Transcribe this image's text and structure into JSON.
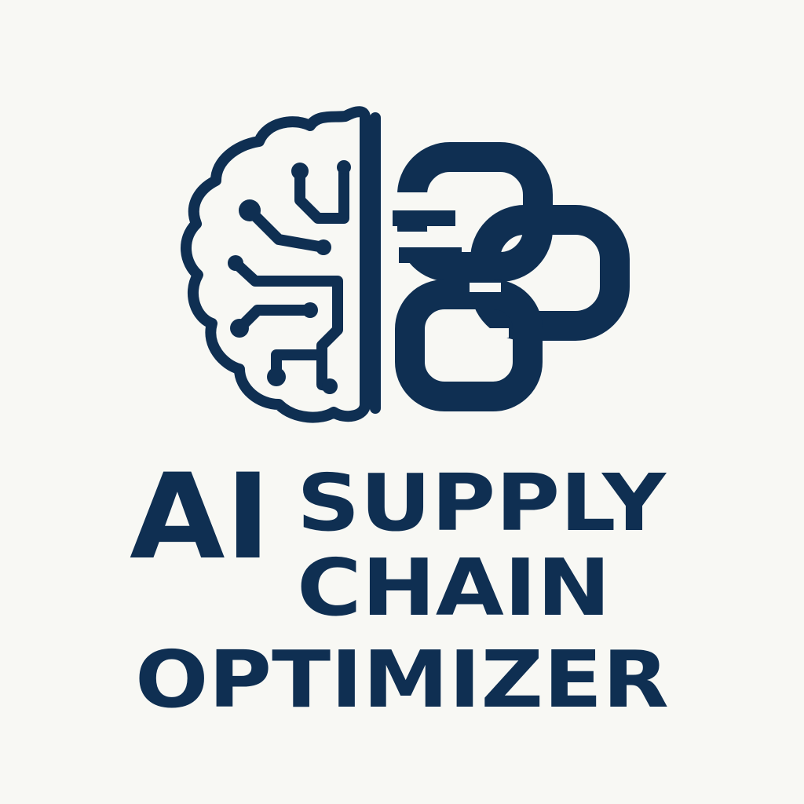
{
  "brand": {
    "primary_color": "#0f2f52",
    "background_color": "#f8f8f4",
    "icon": "brain-circuit-chain-icon"
  },
  "wordmark": {
    "prefix": "AI",
    "line1": "SUPPLY",
    "line2": "CHAIN",
    "line3": "OPTIMIZER"
  }
}
